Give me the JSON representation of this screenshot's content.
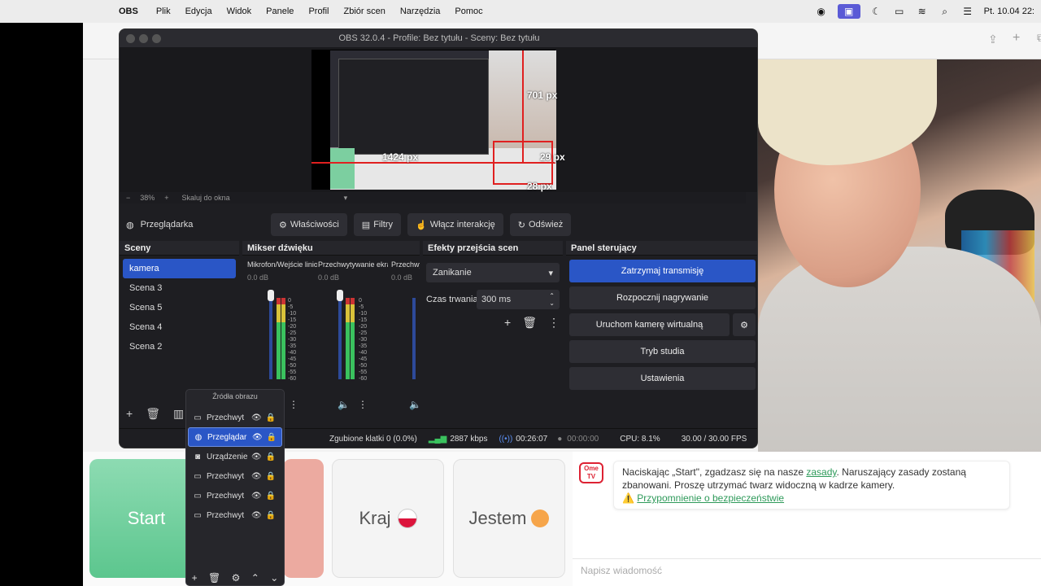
{
  "menubar": {
    "app_name": "OBS",
    "items": [
      "Plik",
      "Edycja",
      "Widok",
      "Panele",
      "Profil",
      "Zbiór scen",
      "Narzędzia",
      "Pomoc"
    ],
    "clock": "Pt. 10.04  22:"
  },
  "obs": {
    "title": "OBS 32.0.4 - Profile: Bez tytułu - Sceny: Bez tytułu",
    "preview": {
      "labels": [
        "701 px",
        "1424 px",
        "29 px",
        "28 px"
      ],
      "zoom": "38%",
      "scale_option": "Skaluj do okna"
    },
    "source_toolbar": {
      "source_name": "Przeglądarka",
      "properties": "Właściwości",
      "filters": "Filtry",
      "interact": "Włącz interakcję",
      "refresh": "Odśwież"
    },
    "scenes": {
      "title": "Sceny",
      "items": [
        "kamera",
        "Scena 3",
        "Scena 5",
        "Scena 4",
        "Scena 2"
      ],
      "active_index": 0
    },
    "mixer": {
      "title": "Mikser dźwięku",
      "channels": [
        {
          "name": "Mikrofon/Wejście liniowe",
          "db": "0.0 dB"
        },
        {
          "name": "Przechwytywanie ekranu",
          "db": "0.0 dB"
        },
        {
          "name": "Przechwytywanie",
          "db": "0.0 dB"
        }
      ],
      "scale": [
        "0",
        "-5",
        "-10",
        "-15",
        "-20",
        "-25",
        "-30",
        "-35",
        "-40",
        "-45",
        "-50",
        "-55",
        "-60"
      ]
    },
    "transitions": {
      "title": "Efekty przejścia scen",
      "selected": "Zanikanie",
      "duration_label": "Czas trwania",
      "duration_value": "300 ms"
    },
    "controls": {
      "title": "Panel sterujący",
      "stop_stream": "Zatrzymaj transmisję",
      "start_recording": "Rozpocznij nagrywanie",
      "virtual_cam": "Uruchom kamerę wirtualną",
      "studio_mode": "Tryb studia",
      "settings": "Ustawienia"
    },
    "status": {
      "dropped": "Zgubione klatki 0 (0.0%)",
      "bitrate": "2887 kbps",
      "stream_time": "00:26:07",
      "rec_time": "00:00:00",
      "cpu": "CPU: 8.1%",
      "fps": "30.00 / 30.00 FPS"
    },
    "sources": {
      "title": "Źródła obrazu",
      "items": [
        {
          "label": "Przechwyt",
          "icon": "monitor-icon"
        },
        {
          "label": "Przeglądar",
          "icon": "globe-icon"
        },
        {
          "label": "Urządzenie",
          "icon": "camera-icon"
        },
        {
          "label": "Przechwyt",
          "icon": "monitor-icon"
        },
        {
          "label": "Przechwyt",
          "icon": "monitor-icon"
        },
        {
          "label": "Przechwyt",
          "icon": "monitor-icon"
        }
      ],
      "active_index": 1
    }
  },
  "page": {
    "start": "Start",
    "country": "Kraj",
    "gender": "Jestem",
    "logo": "Ome TV",
    "chat_message_pre": "Naciskając „Start\", zgadzasz się na nasze ",
    "chat_rules_link": "zasady",
    "chat_message_post": ". Naruszający zasady zostaną zbanowani. Proszę utrzymać twarz widoczną w kadrze kamery.",
    "safety_link": "Przypomnienie o bezpieczeństwie",
    "chat_placeholder": "Napisz wiadomość"
  },
  "colors": {
    "accent": "#2a56c6",
    "start_green": "#5cc68e",
    "link_green": "#2e9a5a"
  }
}
